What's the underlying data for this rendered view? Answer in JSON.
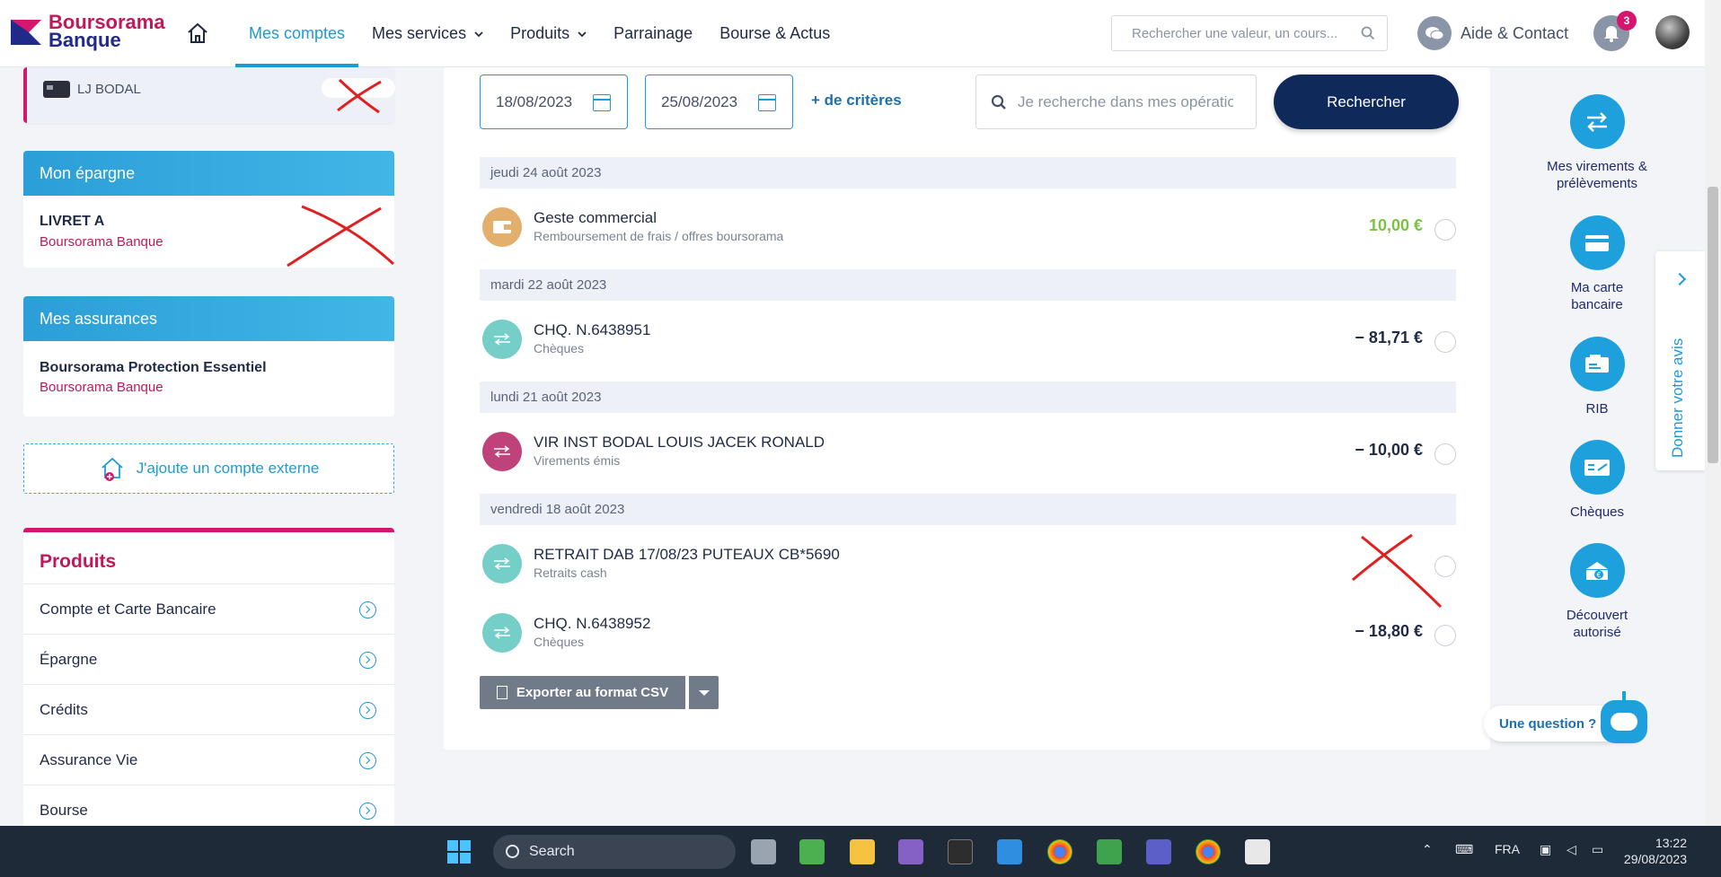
{
  "header": {
    "logo_line1": "Boursorama",
    "logo_line2": "Banque",
    "nav": [
      {
        "label": "Mes comptes",
        "active": true
      },
      {
        "label": "Mes services",
        "dropdown": true
      },
      {
        "label": "Produits",
        "dropdown": true
      },
      {
        "label": "Parrainage"
      },
      {
        "label": "Bourse & Actus"
      }
    ],
    "search_placeholder": "Rechercher une valeur, un cours...",
    "help_label": "Aide & Contact",
    "notifications_count": "3"
  },
  "sidebar": {
    "card_account": "LJ BODAL",
    "savings": {
      "title": "Mon épargne",
      "account_name": "LIVRET A",
      "bank": "Boursorama Banque"
    },
    "insurance": {
      "title": "Mes assurances",
      "account_name": "Boursorama Protection Essentiel",
      "bank": "Boursorama Banque"
    },
    "add_external": "J'ajoute un compte externe",
    "products": {
      "title": "Produits",
      "items": [
        "Compte et Carte Bancaire",
        "Épargne",
        "Crédits",
        "Assurance Vie",
        "Bourse"
      ]
    }
  },
  "filters": {
    "date_from": "18/08/2023",
    "date_to": "25/08/2023",
    "more_criteria": "+ de critères",
    "search_placeholder": "Je recherche dans mes opérations",
    "search_button": "Rechercher"
  },
  "operations": [
    {
      "day": "jeudi 24 août 2023",
      "items": [
        {
          "title": "Geste commercial",
          "category": "Remboursement de frais / offres boursorama",
          "amount": "10,00 €",
          "positive": true,
          "icon": "wallet-icon",
          "icon_color": "#e2b06c"
        }
      ]
    },
    {
      "day": "mardi 22 août 2023",
      "items": [
        {
          "title": "CHQ. N.6438951",
          "category": "Chèques",
          "amount": "− 81,71 €",
          "positive": false,
          "icon": "transfer-icon",
          "icon_color": "#76cec8"
        }
      ]
    },
    {
      "day": "lundi 21 août 2023",
      "items": [
        {
          "title": "VIR INST BODAL LOUIS JACEK RONALD",
          "category": "Virements émis",
          "amount": "− 10,00 €",
          "positive": false,
          "icon": "transfer-icon",
          "icon_color": "#c0427a"
        }
      ]
    },
    {
      "day": "vendredi 18 août 2023",
      "items": [
        {
          "title": "RETRAIT DAB 17/08/23 PUTEAUX CB*5690",
          "category": "Retraits cash",
          "amount": "",
          "positive": false,
          "icon": "transfer-icon",
          "icon_color": "#76cec8"
        },
        {
          "title": "CHQ. N.6438952",
          "category": "Chèques",
          "amount": "− 18,80 €",
          "positive": false,
          "icon": "transfer-icon",
          "icon_color": "#76cec8"
        }
      ]
    }
  ],
  "export_label": "Exporter au format CSV",
  "quick_actions": [
    {
      "label": "Mes virements & prélèvements",
      "icon": "transfer-arrows-icon"
    },
    {
      "label": "Ma carte bancaire",
      "icon": "credit-card-icon"
    },
    {
      "label": "RIB",
      "icon": "rib-icon"
    },
    {
      "label": "Chèques",
      "icon": "cheque-icon"
    },
    {
      "label": "Découvert autorisé",
      "icon": "overdraft-icon"
    }
  ],
  "feedback_tab": "Donner votre avis",
  "chat_label": "Une question ?",
  "taskbar": {
    "search": "Search",
    "lang": "FRA",
    "time": "13:22",
    "date": "29/08/2023"
  },
  "colors": {
    "brand_pink": "#c2185b",
    "brand_blue": "#1e9ad6",
    "navy": "#0f2a5a",
    "positive_green": "#7cc242"
  }
}
